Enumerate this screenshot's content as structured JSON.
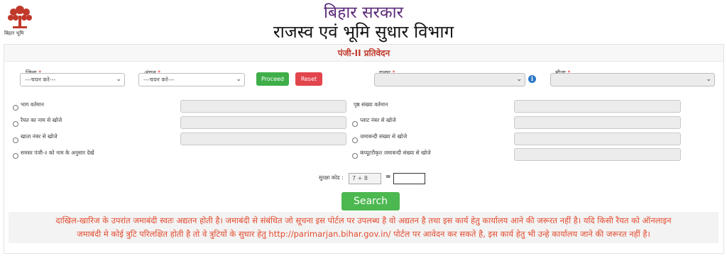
{
  "header": {
    "logo_caption": "बिहार भूमि",
    "title_line1": "बिहार सरकार",
    "title_line2": "राजस्व एवं भूमि सुधार विभाग"
  },
  "panel": {
    "heading": "पंजी-II प्रतिवेदन"
  },
  "filters": {
    "district": {
      "label": "जिला",
      "value": "---चयन करे---"
    },
    "circle": {
      "label": "अंचल",
      "value": "---चयन करे---"
    },
    "proceed_label": "Proceed",
    "reset_label": "Reset",
    "halka": {
      "label": "हल्का",
      "value": ""
    },
    "mauja": {
      "label": "मौजा",
      "value": ""
    },
    "required_mark": "*",
    "info_icon": "i"
  },
  "search_options": {
    "left": [
      "भाग वर्तमान",
      "रैयत का नाम से खोजे",
      "खाता नंबर से खोजे",
      "समस्त पंजी-२ को नाम के अनुसार देखें"
    ],
    "right": [
      "पृष्ठ संख्या वर्तमान",
      "प्लाट नंबर से खोजे",
      "जमाबन्दी संख्या से खोजे",
      "कंप्यूटरीकृत जमाबन्दी संख्या से खोजे"
    ]
  },
  "captcha": {
    "label": "सुरक्षा कोड :",
    "expression": "7 + 8",
    "equals": "=",
    "answer": ""
  },
  "search_label": "Search",
  "notice": {
    "line1": "दाखिल-खारिज के उपरांत जमाबंदी स्वतः अद्यतन होती है। जमाबंदी से संबंधित जो सूचना इस पोर्टल पर उपलब्ध है वो अद्यतन है तथा इस कार्य हेतु कार्यालय आने की जरूरत नहीं है। यदि किसी रैयत को ऑनलाइन",
    "line2": "जमाबंदी मे कोई त्रुटि परिलक्षित होती है तो वे त्रुटियों के सुधार हेतु http://parimarjan.bihar.gov.in/ पोर्टल पर आवेदन कर सकते है, इस कार्य हेतु भी उन्हे कार्यालय जाने की जरूरत नहीं है।"
  },
  "colors": {
    "heading_red": "#c0392b",
    "title_purple": "#5b2a7a",
    "proceed_green": "#3fae49",
    "reset_red": "#e2454c",
    "search_green": "#4cb850",
    "notice_text": "#e34b2e"
  }
}
